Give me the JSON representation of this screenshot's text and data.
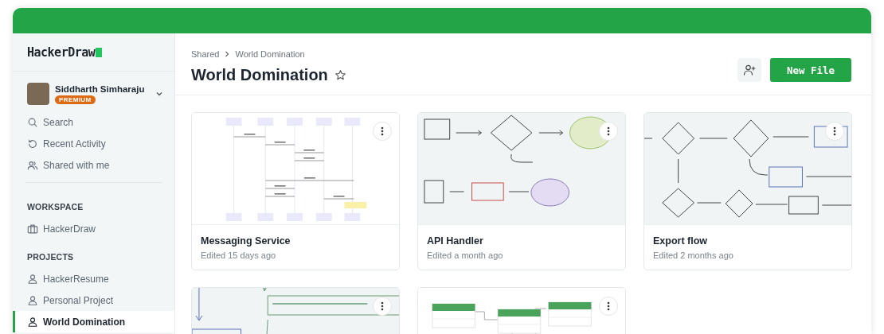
{
  "app": {
    "logo": "HackerDraw"
  },
  "user": {
    "name": "Siddharth Simharaju",
    "badge": "PREMIUM"
  },
  "nav": [
    {
      "label": "Search",
      "kind": "search"
    },
    {
      "label": "Recent Activity",
      "kind": "history"
    },
    {
      "label": "Shared with me",
      "kind": "users"
    }
  ],
  "sections": [
    {
      "title": "WORKSPACE",
      "items": [
        {
          "label": "HackerDraw",
          "kind": "briefcase",
          "selected": false
        }
      ]
    },
    {
      "title": "PROJECTS",
      "items": [
        {
          "label": "HackerResume",
          "kind": "user",
          "selected": false
        },
        {
          "label": "Personal Project",
          "kind": "user",
          "selected": false
        },
        {
          "label": "World Domination",
          "kind": "user",
          "selected": true
        }
      ]
    }
  ],
  "breadcrumbs": [
    "Shared",
    "World Domination"
  ],
  "title": "World Domination",
  "starred": false,
  "new_file_button": "New File",
  "files": [
    {
      "title": "Messaging Service",
      "edited": "Edited 15 days ago",
      "kind": "sequence"
    },
    {
      "title": "API Handler",
      "edited": "Edited a month ago",
      "kind": "sketch"
    },
    {
      "title": "Export flow",
      "edited": "Edited 2 months ago",
      "kind": "flow"
    },
    {
      "kind": "note"
    },
    {
      "kind": "schema"
    }
  ]
}
